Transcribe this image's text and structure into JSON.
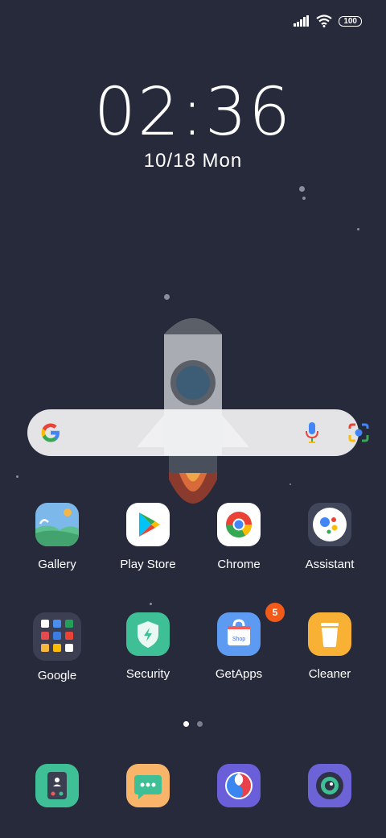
{
  "status_bar": {
    "battery": "100",
    "icons": [
      "signal-icon",
      "wifi-icon",
      "battery-icon"
    ]
  },
  "clock": {
    "time": "02:36",
    "date_num": "10/18",
    "weekday": "Mon"
  },
  "search": {
    "icons": [
      "google-logo-icon",
      "mic-icon",
      "lens-icon"
    ]
  },
  "apps_row1": [
    {
      "label": "Gallery",
      "icon": "gallery-icon"
    },
    {
      "label": "Play Store",
      "icon": "play-store-icon"
    },
    {
      "label": "Chrome",
      "icon": "chrome-icon"
    },
    {
      "label": "Assistant",
      "icon": "assistant-icon"
    }
  ],
  "apps_row2": [
    {
      "label": "Google",
      "icon": "google-folder-icon"
    },
    {
      "label": "Security",
      "icon": "security-icon"
    },
    {
      "label": "GetApps",
      "icon": "getapps-icon",
      "badge": "5",
      "shop_text": "Shop"
    },
    {
      "label": "Cleaner",
      "icon": "cleaner-icon"
    }
  ],
  "dock": [
    {
      "icon": "contacts-icon"
    },
    {
      "icon": "messaging-icon"
    },
    {
      "icon": "browser-icon"
    },
    {
      "icon": "camera-icon"
    }
  ],
  "page_indicator": {
    "count": 2,
    "active": 0
  },
  "colors": {
    "background": "#272a3b",
    "badge": "#f25a1a"
  }
}
